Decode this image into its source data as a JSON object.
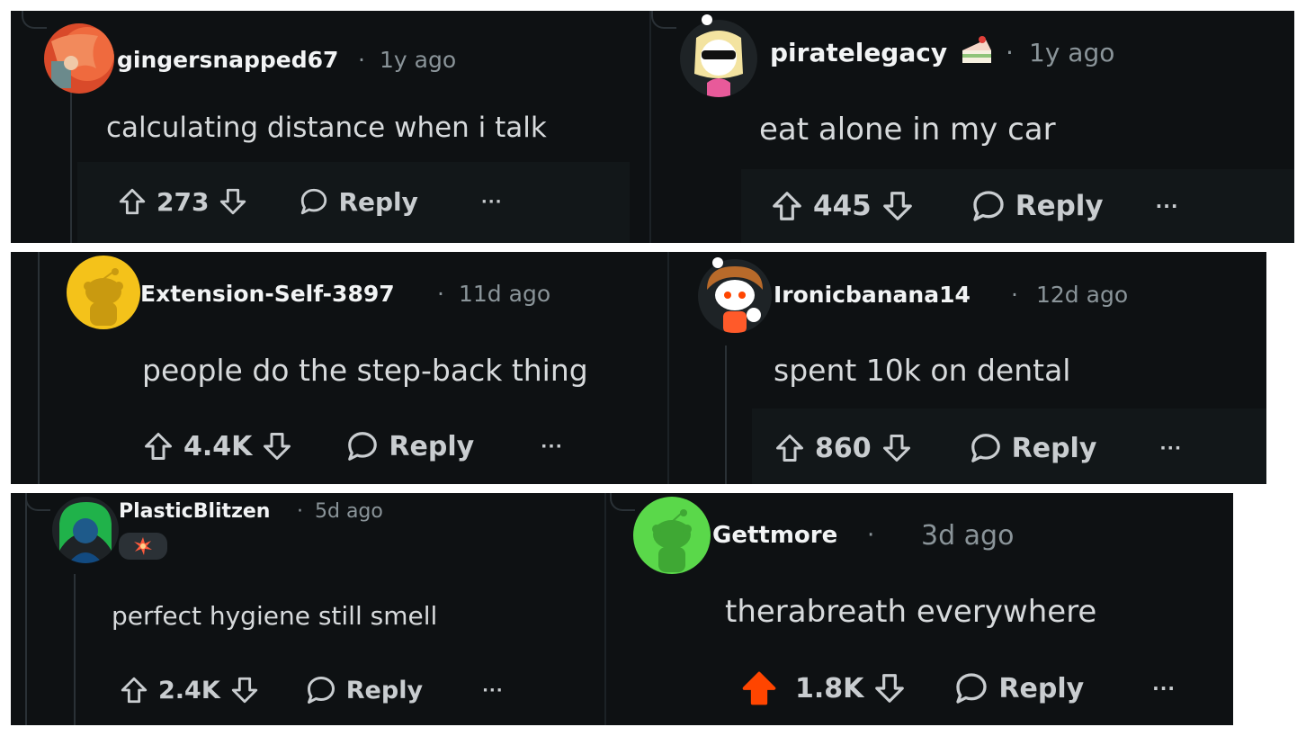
{
  "colors": {
    "background": "#0e1113",
    "text": "#d7dadc",
    "meta": "#8a9499",
    "upvoted": "#ff4500"
  },
  "comments": [
    {
      "username": "gingersnapped67",
      "sep": "·",
      "age": "1y ago",
      "text": "calculating distance when i talk",
      "votes": "273",
      "reply": "Reply",
      "more": "···",
      "avatar": "orange-hair-avatar"
    },
    {
      "username": "piratelegacy",
      "sep": "·",
      "age": "1y ago",
      "text": "eat alone in my car",
      "votes": "445",
      "reply": "Reply",
      "more": "···",
      "avatar": "sunglasses-avatar",
      "badge": "cake-icon"
    },
    {
      "username": "Extension-Self-3897",
      "sep": "·",
      "age": "11d ago",
      "text": "people do the step-back thing",
      "votes": "4.4K",
      "reply": "Reply",
      "more": "···",
      "avatar": "snoo-yellow-avatar"
    },
    {
      "username": "Ironicbanana14",
      "sep": "·",
      "age": "12d ago",
      "text": "spent 10k on dental",
      "votes": "860",
      "reply": "Reply",
      "more": "···",
      "avatar": "snoo-brown-hair-avatar"
    },
    {
      "username": "PlasticBlitzen",
      "sep": "·",
      "age": "5d ago",
      "text": "perfect hygiene still smell",
      "votes": "2.4K",
      "reply": "Reply",
      "more": "···",
      "avatar": "green-hair-avatar",
      "flair": "explosion-icon"
    },
    {
      "username": "Gettmore",
      "sep": "·",
      "age": "3d ago",
      "text": "therabreath everywhere",
      "votes": "1.8K",
      "reply": "Reply",
      "more": "···",
      "avatar": "snoo-green-avatar",
      "upvoted": true
    }
  ]
}
